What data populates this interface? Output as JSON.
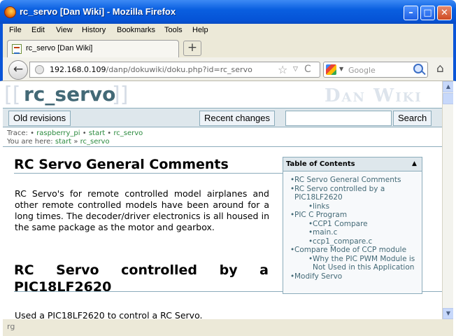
{
  "window": {
    "title": "rc_servo [Dan Wiki] - Mozilla Firefox",
    "minimize": "–",
    "maximize": "□",
    "close": "✕"
  },
  "menu": [
    "File",
    "Edit",
    "View",
    "History",
    "Bookmarks",
    "Tools",
    "Help"
  ],
  "tab": {
    "label": "rc_servo [Dan Wiki]",
    "new_tab": "+"
  },
  "nav": {
    "url_host": "192.168.0.109",
    "url_path": "/danp/dokuwiki/doku.php?id=rc_servo",
    "search_placeholder": "Google",
    "back": "←",
    "star": "☆",
    "dropdown": "▽",
    "reload": "C",
    "home": "⌂",
    "icons": [
      "back-arrow-icon",
      "globe-icon",
      "bookmark-star-icon",
      "dropdown-arrow-icon",
      "reload-icon",
      "google-icon",
      "magnifier-icon",
      "home-icon"
    ]
  },
  "wiki": {
    "bracket_open": "[[",
    "page_id": "rc_servo",
    "bracket_close": "]]",
    "site_title": "Dan Wiki",
    "buttons": {
      "old_revisions": "Old revisions",
      "recent_changes": "Recent changes",
      "search": "Search"
    },
    "search_value": "",
    "trace": {
      "label": "Trace:",
      "items": [
        "raspberry_pi",
        "start",
        "rc_servo"
      ]
    },
    "you_are_here": {
      "label": "You are here:",
      "items": [
        "start",
        "rc_servo"
      ],
      "sep": "»"
    },
    "colors": {
      "accent": "#436976",
      "toolbar_bg": "#dee7ec",
      "border": "#8cacbb",
      "link": "#2b8a3e"
    }
  },
  "content": {
    "h1": "RC Servo General Comments",
    "p1": "RC Servo's for remote controlled model airplanes and other remote controlled models have been around for a long times. The decoder/driver electronics is all housed in the same package as the motor and gearbox.",
    "h2": "RC Servo controlled by a PIC18LF2620",
    "p2": "Used a PIC18LF2620 to control a RC Servo."
  },
  "toc": {
    "title": "Table of Contents",
    "toggle": "▲",
    "entries": [
      {
        "text": "RC Servo General Comments",
        "level": 1
      },
      {
        "text": "RC Servo controlled by a PIC18LF2620",
        "level": 1
      },
      {
        "text": "links",
        "level": 2
      },
      {
        "text": "PIC C Program",
        "level": 1
      },
      {
        "text": "CCP1 Compare",
        "level": 2
      },
      {
        "text": "main.c",
        "level": 2
      },
      {
        "text": "ccp1_compare.c",
        "level": 2
      },
      {
        "text": "Compare Mode of CCP module",
        "level": 1
      },
      {
        "text": "Why the PIC PWM Module is Not Used in this Application",
        "level": 2
      },
      {
        "text": "Modify Servo",
        "level": 1
      }
    ]
  },
  "scrollbar": {
    "up": "▲",
    "down": "▼"
  },
  "status": "rg"
}
